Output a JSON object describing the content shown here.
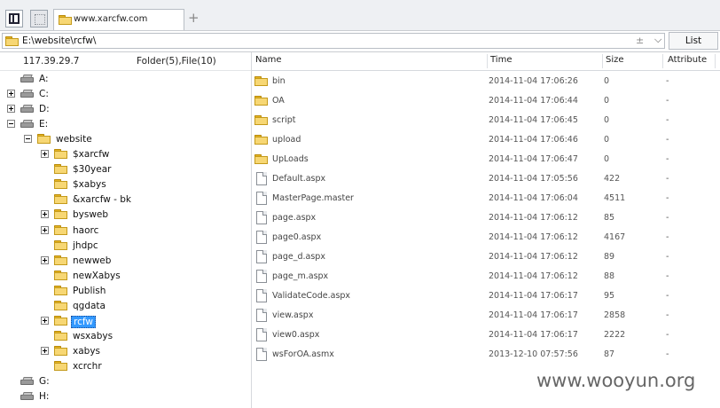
{
  "tab": {
    "title": "www.xarcfw.com",
    "new_tab": "+"
  },
  "address": {
    "path": "E:\\website\\rcfw\\",
    "plus": "±",
    "chevron": "⌵",
    "list_label": "List"
  },
  "left": {
    "ip": "117.39.29.7",
    "count": "Folder(5),File(10)",
    "tree": [
      {
        "label": "A:",
        "type": "drive",
        "level": 0,
        "expander": "none"
      },
      {
        "label": "C:",
        "type": "drive",
        "level": 0,
        "expander": "plus"
      },
      {
        "label": "D:",
        "type": "drive",
        "level": 0,
        "expander": "plus"
      },
      {
        "label": "E:",
        "type": "drive",
        "level": 0,
        "expander": "minus"
      },
      {
        "label": "website",
        "type": "folder",
        "level": 1,
        "expander": "minus"
      },
      {
        "label": "$xarcfw",
        "type": "folder",
        "level": 2,
        "expander": "plus"
      },
      {
        "label": "$30year",
        "type": "folder",
        "level": 2,
        "expander": "none"
      },
      {
        "label": "$xabys",
        "type": "folder",
        "level": 2,
        "expander": "none"
      },
      {
        "label": "&xarcfw - bk",
        "type": "folder",
        "level": 2,
        "expander": "none"
      },
      {
        "label": "bysweb",
        "type": "folder",
        "level": 2,
        "expander": "plus"
      },
      {
        "label": "haorc",
        "type": "folder",
        "level": 2,
        "expander": "plus"
      },
      {
        "label": "jhdpc",
        "type": "folder",
        "level": 2,
        "expander": "none"
      },
      {
        "label": "newweb",
        "type": "folder",
        "level": 2,
        "expander": "plus"
      },
      {
        "label": "newXabys",
        "type": "folder",
        "level": 2,
        "expander": "none"
      },
      {
        "label": "Publish",
        "type": "folder",
        "level": 2,
        "expander": "none"
      },
      {
        "label": "qgdata",
        "type": "folder",
        "level": 2,
        "expander": "none"
      },
      {
        "label": "rcfw",
        "type": "folder",
        "level": 2,
        "expander": "plus",
        "selected": true
      },
      {
        "label": "wsxabys",
        "type": "folder",
        "level": 2,
        "expander": "none"
      },
      {
        "label": "xabys",
        "type": "folder",
        "level": 2,
        "expander": "plus"
      },
      {
        "label": "xcrchr",
        "type": "folder",
        "level": 2,
        "expander": "none"
      },
      {
        "label": "G:",
        "type": "drive",
        "level": 0,
        "expander": "none"
      },
      {
        "label": "H:",
        "type": "drive",
        "level": 0,
        "expander": "none"
      }
    ]
  },
  "columns": {
    "name": "Name",
    "time": "Time",
    "size": "Size",
    "attribute": "Attribute"
  },
  "files": [
    {
      "name": "bin",
      "type": "folder",
      "time": "2014-11-04 17:06:26",
      "size": "0",
      "attr": "-"
    },
    {
      "name": "OA",
      "type": "folder",
      "time": "2014-11-04 17:06:44",
      "size": "0",
      "attr": "-"
    },
    {
      "name": "script",
      "type": "folder",
      "time": "2014-11-04 17:06:45",
      "size": "0",
      "attr": "-"
    },
    {
      "name": "upload",
      "type": "folder",
      "time": "2014-11-04 17:06:46",
      "size": "0",
      "attr": "-"
    },
    {
      "name": "UpLoads",
      "type": "folder",
      "time": "2014-11-04 17:06:47",
      "size": "0",
      "attr": "-"
    },
    {
      "name": "Default.aspx",
      "type": "file",
      "time": "2014-11-04 17:05:56",
      "size": "422",
      "attr": "-"
    },
    {
      "name": "MasterPage.master",
      "type": "file",
      "time": "2014-11-04 17:06:04",
      "size": "4511",
      "attr": "-"
    },
    {
      "name": "page.aspx",
      "type": "file",
      "time": "2014-11-04 17:06:12",
      "size": "85",
      "attr": "-"
    },
    {
      "name": "page0.aspx",
      "type": "file",
      "time": "2014-11-04 17:06:12",
      "size": "4167",
      "attr": "-"
    },
    {
      "name": "page_d.aspx",
      "type": "file",
      "time": "2014-11-04 17:06:12",
      "size": "89",
      "attr": "-"
    },
    {
      "name": "page_m.aspx",
      "type": "file",
      "time": "2014-11-04 17:06:12",
      "size": "88",
      "attr": "-"
    },
    {
      "name": "ValidateCode.aspx",
      "type": "file",
      "time": "2014-11-04 17:06:17",
      "size": "95",
      "attr": "-"
    },
    {
      "name": "view.aspx",
      "type": "file",
      "time": "2014-11-04 17:06:17",
      "size": "2858",
      "attr": "-"
    },
    {
      "name": "view0.aspx",
      "type": "file",
      "time": "2014-11-04 17:06:17",
      "size": "2222",
      "attr": "-"
    },
    {
      "name": "wsForOA.asmx",
      "type": "file",
      "time": "2013-12-10 07:57:56",
      "size": "87",
      "attr": "-"
    }
  ],
  "watermark": "www.wooyun.org"
}
